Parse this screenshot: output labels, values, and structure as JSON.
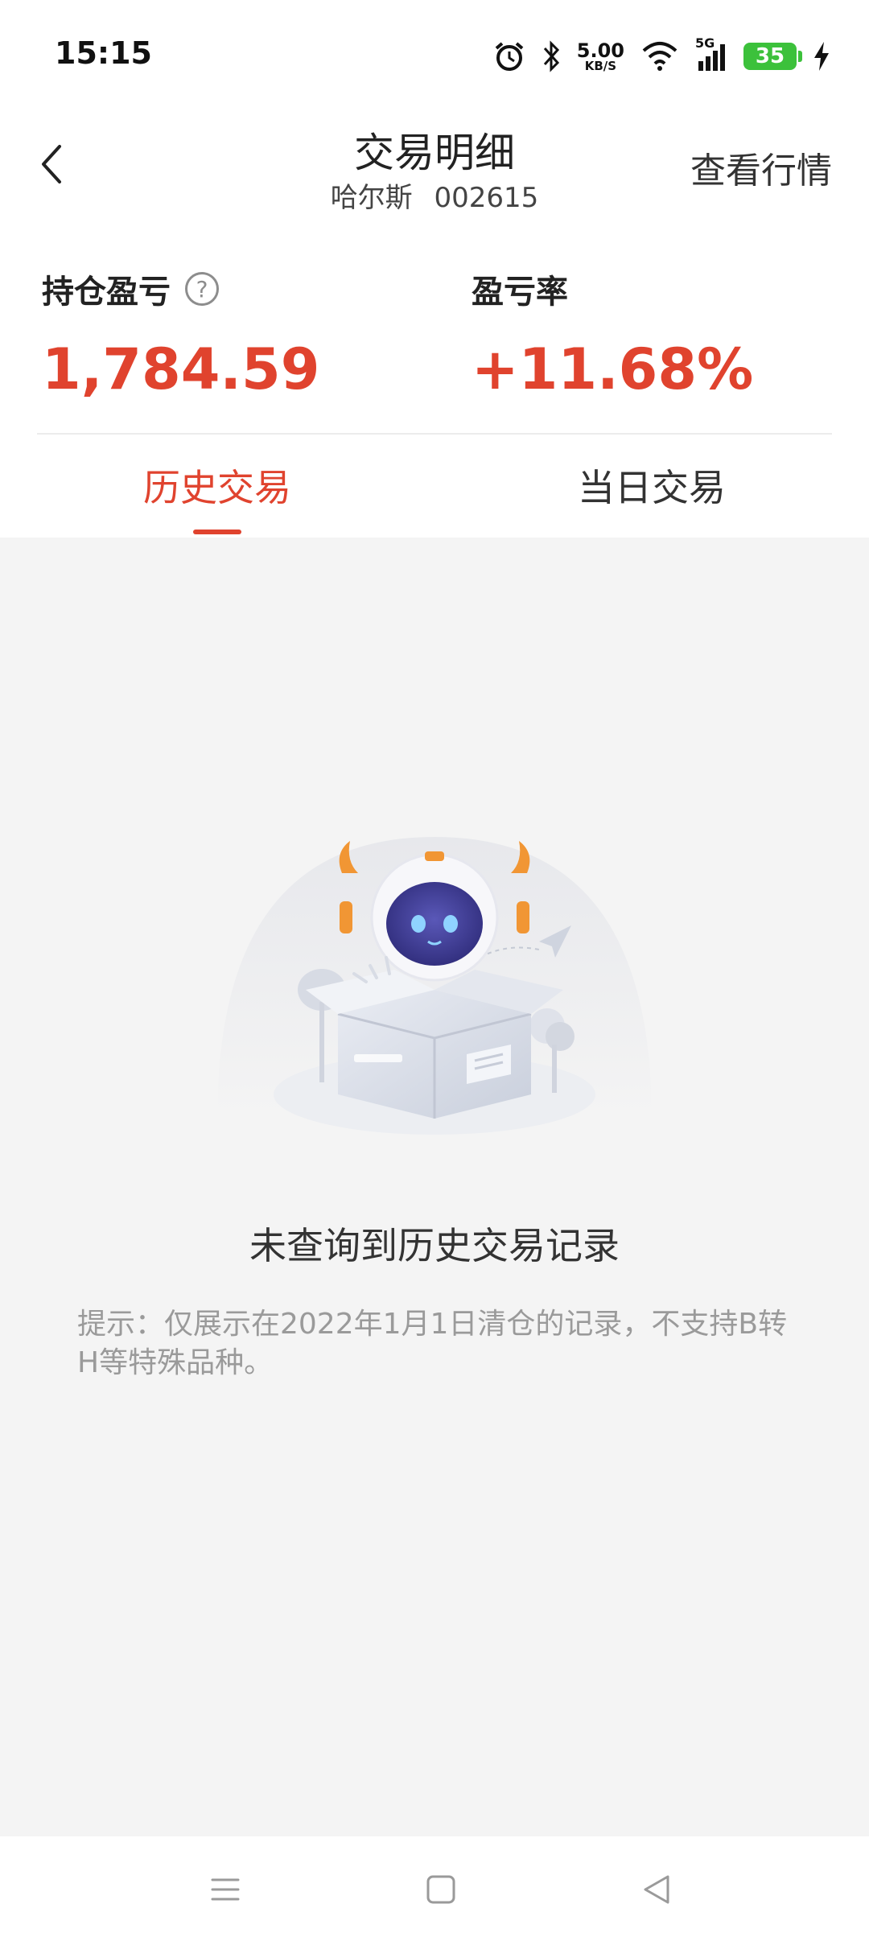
{
  "status_bar": {
    "time": "15:15",
    "net_speed_value": "5.00",
    "net_speed_unit": "KB/S",
    "network_type": "5G",
    "battery": "35",
    "icons": [
      "alarm-icon",
      "bluetooth-icon",
      "wifi-icon",
      "signal-icon",
      "battery-icon",
      "charging-icon"
    ]
  },
  "header": {
    "back_icon": "chevron-left-icon",
    "title": "交易明细",
    "stock_name": "哈尔斯",
    "stock_code": "002615",
    "market_link": "查看行情"
  },
  "stats": {
    "pnl_label": "持仓盈亏",
    "pnl_help_icon": "question-circle-icon",
    "pnl_value": "1,784.59",
    "rate_label": "盈亏率",
    "rate_value": "+11.68%"
  },
  "tabs": [
    {
      "label": "历史交易",
      "active": true
    },
    {
      "label": "当日交易",
      "active": false
    }
  ],
  "empty_state": {
    "illustration": "robot-in-box-illustration",
    "title": "未查询到历史交易记录",
    "hint": "提示：仅展示在2022年1月1日清仓的记录，不支持B转H等特殊品种。"
  },
  "nav_bar": {
    "icons": [
      "menu-icon",
      "home-icon",
      "back-triangle-icon"
    ]
  },
  "colors": {
    "accent": "#e0432e",
    "battery": "#3cc13b",
    "background": "#f4f4f4"
  }
}
